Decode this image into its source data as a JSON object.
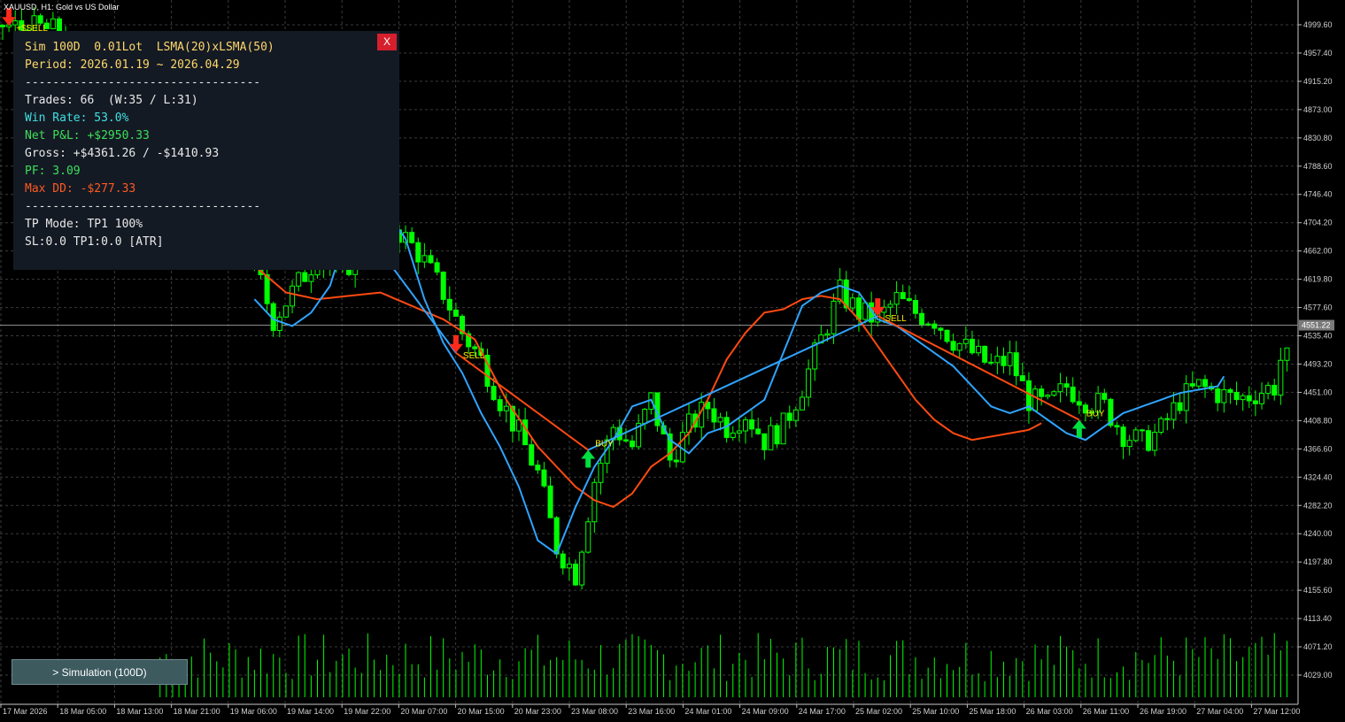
{
  "window": {
    "title": "XAUUSD, H1:  Gold vs US Dollar"
  },
  "colors": {
    "background": "#000000",
    "grid": "#3a3a3a",
    "bull": "#00ff00",
    "bear": "#00ff00",
    "lsma_fast": "#2fa4ff",
    "lsma_slow": "#ff4a12",
    "buy_arrow": "#00e040",
    "sell_arrow": "#ff2a1a",
    "signal_text": "#ffee00",
    "cyan": "#3fe0e0",
    "green": "#3ce05a",
    "red": "#ff4a12"
  },
  "panel": {
    "close_label": "X",
    "header": "Sim 100D  0.01Lot  LSMA(20)xLSMA(50)",
    "period": "Period: 2026.01.19 ~ 2026.04.29",
    "divider": "----------------------------------",
    "trades": "Trades: 66  (W:35 / L:31)",
    "win_rate": "Win Rate: 53.0%",
    "net_pl": "Net P&L: +$2950.33",
    "gross": "Gross: +$4361.26 / -$1410.93",
    "pf": "PF: 3.09",
    "max_dd": "Max DD: -$277.33",
    "divider2": "----------------------------------",
    "tp_mode": "TP Mode: TP1 100%",
    "sl_tp": "SL:0.0 TP1:0.0 [ATR]"
  },
  "sim_button": {
    "label": "> Simulation (100D)"
  },
  "current_price": "4551.22",
  "chart_data": {
    "type": "candlestick",
    "price_ticks": [
      "4999.60",
      "4957.40",
      "4915.20",
      "4873.00",
      "4830.80",
      "4788.60",
      "4746.40",
      "4704.20",
      "4662.00",
      "4619.80",
      "4577.60",
      "4535.40",
      "4493.20",
      "4451.00",
      "4408.80",
      "4366.60",
      "4324.40",
      "4282.20",
      "4240.00",
      "4197.80",
      "4155.60",
      "4113.40",
      "4071.20",
      "4029.00"
    ],
    "time_ticks": [
      "17 Mar 2026",
      "18 Mar 05:00",
      "18 Mar 13:00",
      "18 Mar 21:00",
      "19 Mar 06:00",
      "19 Mar 14:00",
      "19 Mar 22:00",
      "20 Mar 07:00",
      "20 Mar 15:00",
      "20 Mar 23:00",
      "23 Mar 08:00",
      "23 Mar 16:00",
      "24 Mar 01:00",
      "24 Mar 09:00",
      "24 Mar 17:00",
      "25 Mar 02:00",
      "25 Mar 10:00",
      "25 Mar 18:00",
      "26 Mar 03:00",
      "26 Mar 11:00",
      "26 Mar 19:00",
      "27 Mar 04:00",
      "27 Mar 12:00"
    ],
    "ylim": [
      4000,
      5010
    ],
    "close_keypoints": [
      [
        0,
        4999
      ],
      [
        4,
        4992
      ],
      [
        6,
        4995
      ],
      [
        8,
        4990
      ],
      [
        10,
        4985
      ],
      [
        40,
        4640
      ],
      [
        43,
        4560
      ],
      [
        46,
        4600
      ],
      [
        50,
        4655
      ],
      [
        54,
        4620
      ],
      [
        57,
        4690
      ],
      [
        60,
        4720
      ],
      [
        63,
        4690
      ],
      [
        66,
        4660
      ],
      [
        70,
        4600
      ],
      [
        73,
        4540
      ],
      [
        76,
        4500
      ],
      [
        79,
        4440
      ],
      [
        82,
        4390
      ],
      [
        85,
        4330
      ],
      [
        88,
        4220
      ],
      [
        91,
        4180
      ],
      [
        94,
        4320
      ],
      [
        97,
        4400
      ],
      [
        100,
        4370
      ],
      [
        103,
        4440
      ],
      [
        106,
        4350
      ],
      [
        109,
        4400
      ],
      [
        112,
        4430
      ],
      [
        115,
        4400
      ],
      [
        118,
        4420
      ],
      [
        121,
        4380
      ],
      [
        124,
        4400
      ],
      [
        127,
        4460
      ],
      [
        130,
        4530
      ],
      [
        133,
        4600
      ],
      [
        136,
        4570
      ],
      [
        139,
        4560
      ],
      [
        142,
        4590
      ],
      [
        145,
        4570
      ],
      [
        148,
        4560
      ],
      [
        151,
        4530
      ],
      [
        154,
        4510
      ],
      [
        157,
        4490
      ],
      [
        160,
        4500
      ],
      [
        163,
        4440
      ],
      [
        166,
        4430
      ],
      [
        169,
        4460
      ],
      [
        172,
        4440
      ],
      [
        175,
        4430
      ],
      [
        178,
        4390
      ],
      [
        181,
        4375
      ],
      [
        184,
        4395
      ],
      [
        187,
        4440
      ],
      [
        190,
        4460
      ],
      [
        193,
        4450
      ],
      [
        196,
        4440
      ],
      [
        199,
        4450
      ],
      [
        202,
        4460
      ],
      [
        203,
        4500
      ]
    ],
    "lsma_fast_keypoints": [
      [
        40,
        4590
      ],
      [
        43,
        4560
      ],
      [
        46,
        4550
      ],
      [
        49,
        4570
      ],
      [
        52,
        4610
      ],
      [
        55,
        4700
      ],
      [
        58,
        4700
      ],
      [
        61,
        4720
      ],
      [
        64,
        4680
      ],
      [
        67,
        4590
      ],
      [
        70,
        4525
      ],
      [
        73,
        4480
      ],
      [
        76,
        4420
      ],
      [
        79,
        4370
      ],
      [
        82,
        4310
      ],
      [
        85,
        4230
      ],
      [
        88,
        4210
      ],
      [
        91,
        4280
      ],
      [
        94,
        4340
      ],
      [
        97,
        4380
      ],
      [
        100,
        4430
      ],
      [
        103,
        4440
      ],
      [
        106,
        4380
      ],
      [
        109,
        4360
      ],
      [
        112,
        4390
      ],
      [
        115,
        4400
      ],
      [
        118,
        4420
      ],
      [
        121,
        4440
      ],
      [
        124,
        4510
      ],
      [
        127,
        4580
      ],
      [
        130,
        4600
      ],
      [
        133,
        4610
      ],
      [
        136,
        4600
      ],
      [
        139,
        4560
      ],
      [
        142,
        4550
      ],
      [
        145,
        4530
      ],
      [
        148,
        4510
      ],
      [
        151,
        4490
      ],
      [
        154,
        4460
      ],
      [
        157,
        4430
      ],
      [
        160,
        4420
      ],
      [
        163,
        4430
      ],
      [
        166,
        4410
      ],
      [
        169,
        4390
      ],
      [
        172,
        4380
      ],
      [
        175,
        4400
      ],
      [
        178,
        4420
      ],
      [
        181,
        4430
      ],
      [
        184,
        4440
      ],
      [
        187,
        4450
      ],
      [
        190,
        4455
      ],
      [
        193,
        4460
      ],
      [
        194,
        4475
      ]
    ],
    "lsma_slow_keypoints": [
      [
        40,
        4640
      ],
      [
        45,
        4600
      ],
      [
        50,
        4590
      ],
      [
        55,
        4595
      ],
      [
        60,
        4600
      ],
      [
        65,
        4580
      ],
      [
        70,
        4560
      ],
      [
        75,
        4530
      ],
      [
        80,
        4440
      ],
      [
        85,
        4370
      ],
      [
        88,
        4340
      ],
      [
        91,
        4310
      ],
      [
        94,
        4290
      ],
      [
        97,
        4280
      ],
      [
        100,
        4300
      ],
      [
        103,
        4340
      ],
      [
        106,
        4360
      ],
      [
        109,
        4390
      ],
      [
        112,
        4440
      ],
      [
        115,
        4500
      ],
      [
        118,
        4540
      ],
      [
        121,
        4570
      ],
      [
        124,
        4575
      ],
      [
        127,
        4590
      ],
      [
        130,
        4595
      ],
      [
        133,
        4590
      ],
      [
        136,
        4560
      ],
      [
        139,
        4520
      ],
      [
        142,
        4480
      ],
      [
        145,
        4440
      ],
      [
        148,
        4410
      ],
      [
        151,
        4390
      ],
      [
        154,
        4380
      ],
      [
        157,
        4385
      ],
      [
        160,
        4390
      ],
      [
        163,
        4395
      ],
      [
        165,
        4405
      ]
    ],
    "signals": [
      {
        "type": "sell",
        "index": 1,
        "price": 4998,
        "label": "+$SELL"
      },
      {
        "type": "buy",
        "index": 57,
        "price": 4700,
        "label": "BUY"
      },
      {
        "type": "sell",
        "index": 72,
        "price": 4510,
        "label": "SELL"
      },
      {
        "type": "buy",
        "index": 93,
        "price": 4365,
        "label": "BUY"
      },
      {
        "type": "sell",
        "index": 139,
        "price": 4565,
        "label": "SELL"
      },
      {
        "type": "buy",
        "index": 171,
        "price": 4410,
        "label": "BUY"
      }
    ]
  }
}
